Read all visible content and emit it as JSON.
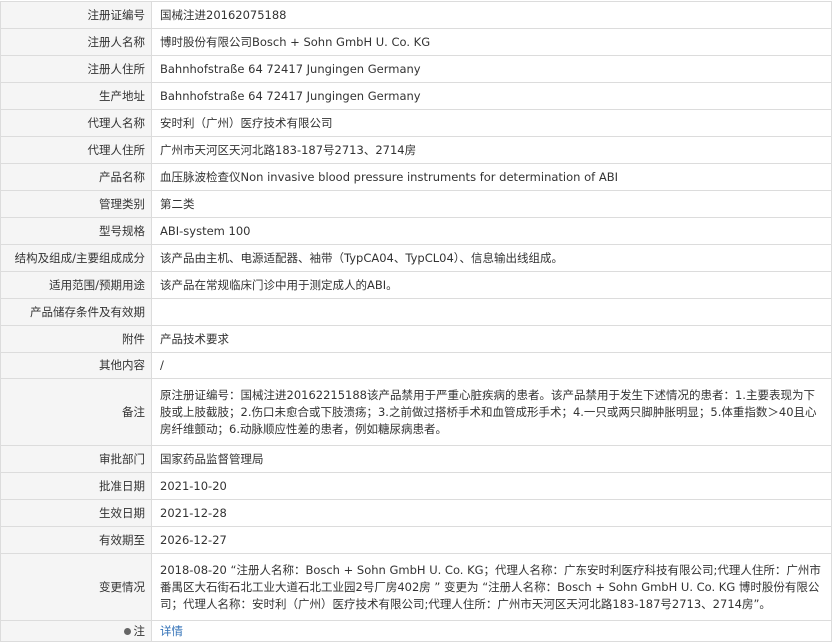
{
  "rows": [
    {
      "label": "注册证编号",
      "value": "国械注进20162075188"
    },
    {
      "label": "注册人名称",
      "value": "博时股份有限公司Bosch + Sohn GmbH U. Co. KG"
    },
    {
      "label": "注册人住所",
      "value": "Bahnhofstraße 64 72417 Jungingen Germany"
    },
    {
      "label": "生产地址",
      "value": "Bahnhofstraße 64 72417 Jungingen Germany"
    },
    {
      "label": "代理人名称",
      "value": "安时利（广州）医疗技术有限公司"
    },
    {
      "label": "代理人住所",
      "value": "广州市天河区天河北路183-187号2713、2714房"
    },
    {
      "label": "产品名称",
      "value": "血压脉波检查仪Non invasive blood pressure instruments for determination of ABI"
    },
    {
      "label": "管理类别",
      "value": "第二类"
    },
    {
      "label": "型号规格",
      "value": "ABI-system 100"
    },
    {
      "label": "结构及组成/主要组成成分",
      "value": "该产品由主机、电源适配器、袖带（TypCA04、TypCL04）、信息输出线组成。"
    },
    {
      "label": "适用范围/预期用途",
      "value": "该产品在常规临床门诊中用于测定成人的ABI。"
    },
    {
      "label": "产品储存条件及有效期",
      "value": ""
    },
    {
      "label": "附件",
      "value": "产品技术要求"
    },
    {
      "label": "其他内容",
      "value": "/"
    },
    {
      "label": "备注",
      "value": "原注册证编号：国械注进20162215188该产品禁用于严重心脏疾病的患者。该产品禁用于发生下述情况的患者：1.主要表现为下肢或上肢截肢；2.伤口未愈合或下肢溃疡；3.之前做过搭桥手术和血管成形手术；4.一只或两只脚肿胀明显；5.体重指数＞40且心房纤维颤动；6.动脉顺应性差的患者，例如糖尿病患者。"
    },
    {
      "label": "审批部门",
      "value": "国家药品监督管理局"
    },
    {
      "label": "批准日期",
      "value": "2021-10-20"
    },
    {
      "label": "生效日期",
      "value": "2021-12-28"
    },
    {
      "label": "有效期至",
      "value": "2026-12-27"
    },
    {
      "label": "变更情况",
      "value": "2018-08-20 “注册人名称：Bosch + Sohn GmbH U. Co. KG；代理人名称：广东安时利医疗科技有限公司;代理人住所：广州市番禺区大石街石北工业大道石北工业园2号厂房402房 ” 变更为 “注册人名称：Bosch + Sohn GmbH U. Co. KG 博时股份有限公司；代理人名称：安时利（广州）医疗技术有限公司;代理人住所：广州市天河区天河北路183-187号2713、2714房”。"
    }
  ],
  "note": {
    "label": "注",
    "link_text": "详情"
  },
  "colors": {
    "label_bg": "#f5f5f5",
    "border": "#dcdcdc",
    "link": "#2f6fb6"
  }
}
